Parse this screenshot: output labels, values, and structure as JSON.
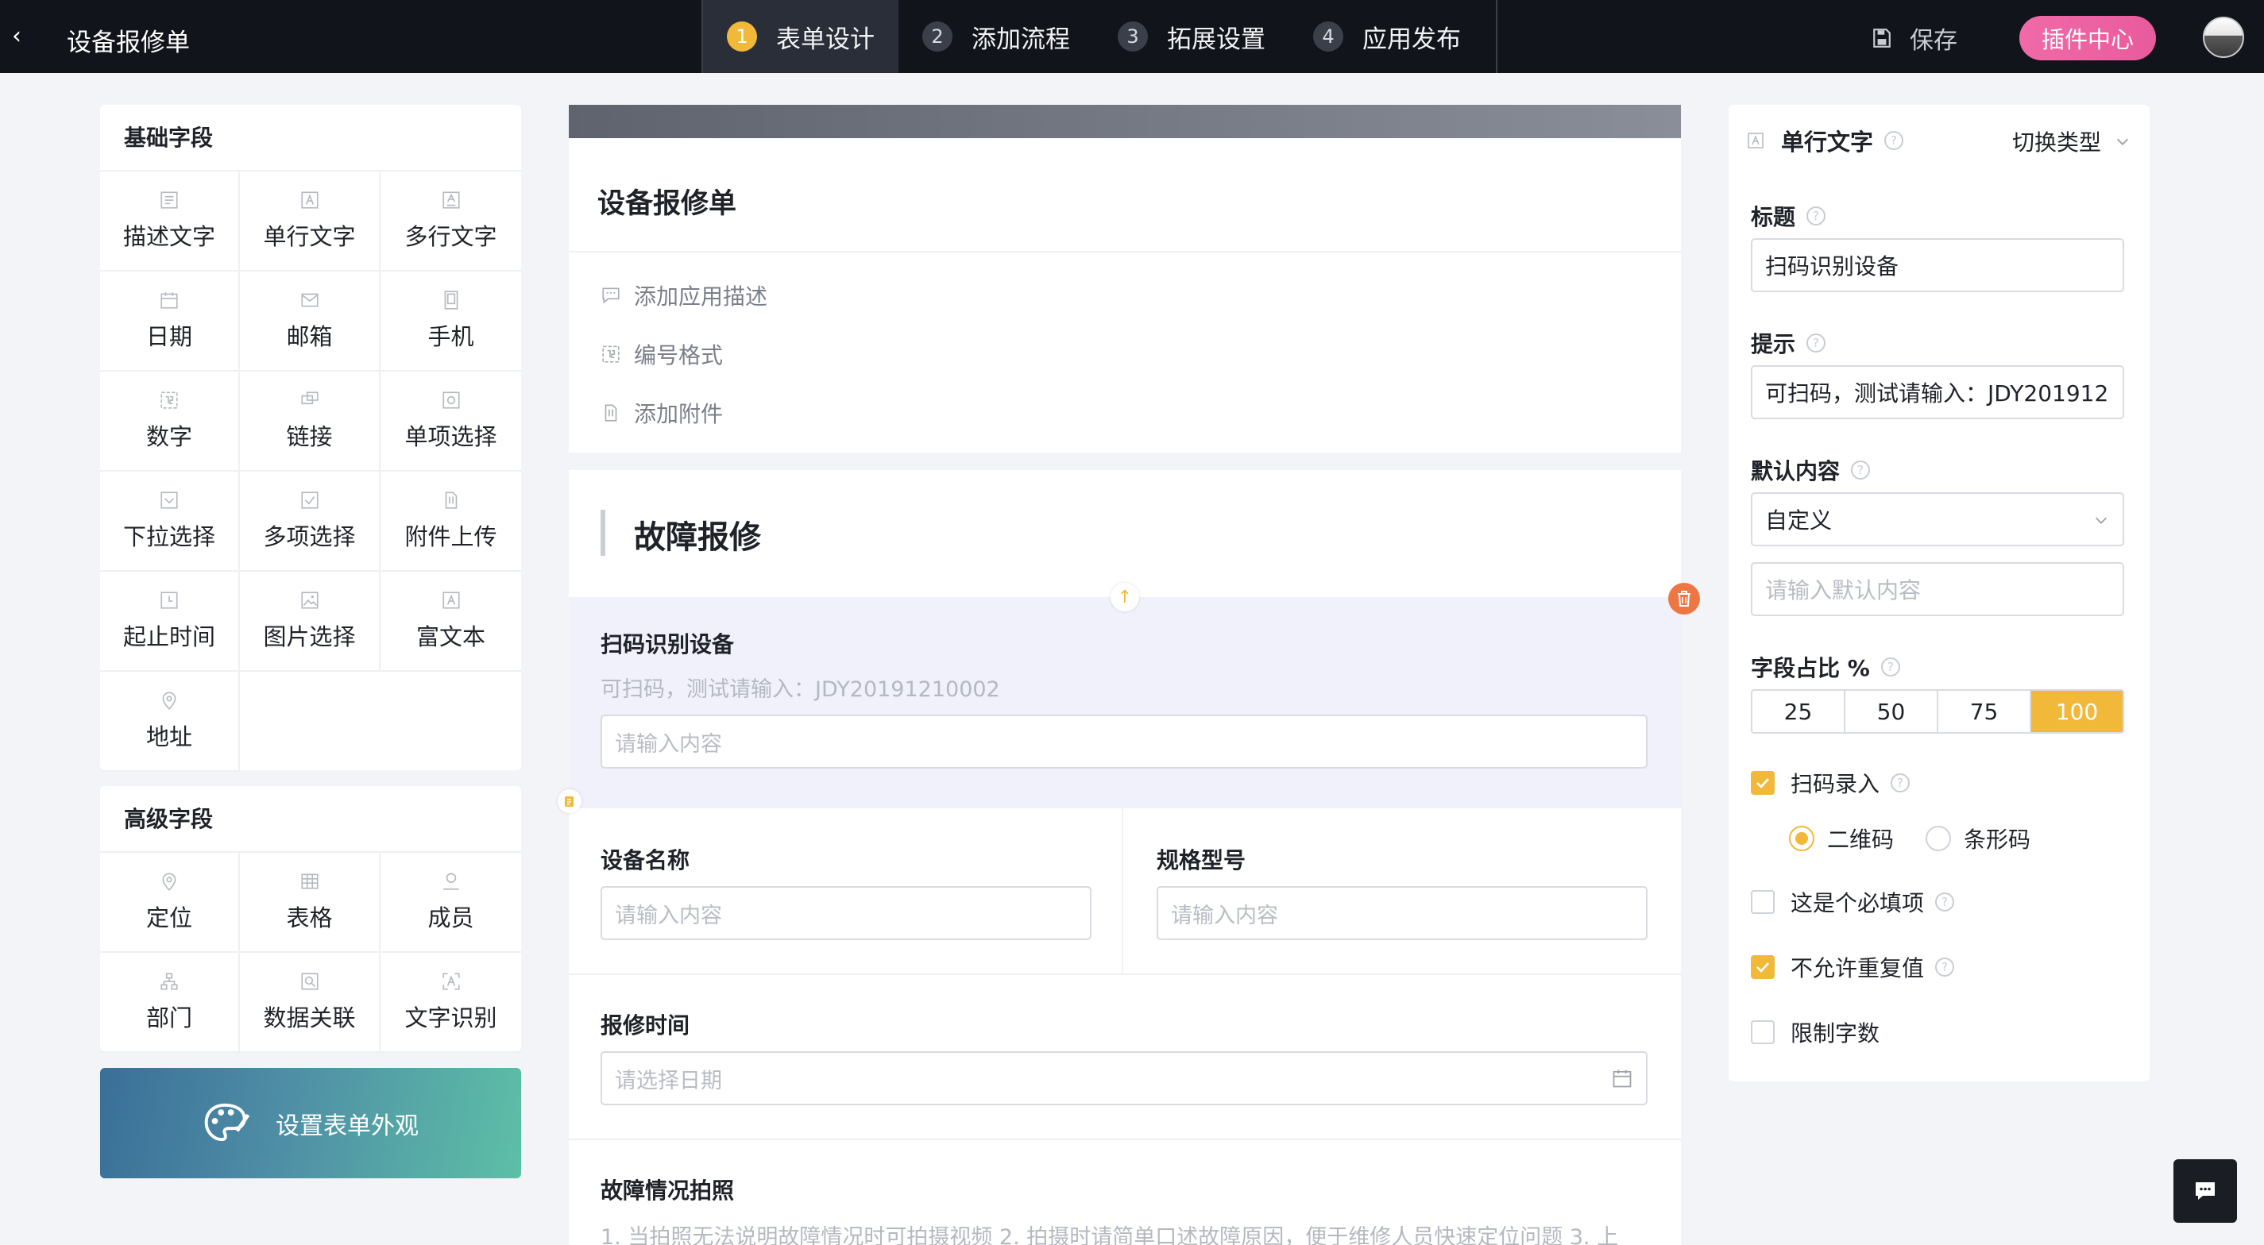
{
  "header": {
    "title": "设备报修单",
    "steps": [
      {
        "num": "1",
        "label": "表单设计"
      },
      {
        "num": "2",
        "label": "添加流程"
      },
      {
        "num": "3",
        "label": "拓展设置"
      },
      {
        "num": "4",
        "label": "应用发布"
      }
    ],
    "save_label": "保存",
    "plugin_label": "插件中心"
  },
  "left": {
    "basic_title": "基础字段",
    "basic_items": [
      "描述文字",
      "单行文字",
      "多行文字",
      "日期",
      "邮箱",
      "手机",
      "数字",
      "链接",
      "单项选择",
      "下拉选择",
      "多项选择",
      "附件上传",
      "起止时间",
      "图片选择",
      "富文本",
      "地址"
    ],
    "advanced_title": "高级字段",
    "advanced_items": [
      "定位",
      "表格",
      "成员",
      "部门",
      "数据关联",
      "文字识别"
    ],
    "appearance_label": "设置表单外观"
  },
  "form": {
    "title": "设备报修单",
    "links": [
      "添加应用描述",
      "编号格式",
      "添加附件"
    ],
    "section_title": "故障报修",
    "fields": {
      "scan": {
        "label": "扫码识别设备",
        "hint": "可扫码，测试请输入：JDY20191210002",
        "placeholder": "请输入内容"
      },
      "name": {
        "label": "设备名称",
        "placeholder": "请输入内容"
      },
      "model": {
        "label": "规格型号",
        "placeholder": "请输入内容"
      },
      "time": {
        "label": "报修时间",
        "placeholder": "请选择日期"
      },
      "photo": {
        "label": "故障情况拍照",
        "hint": "1. 当拍照无法说明故障情况时可拍摄视频 2. 拍摄时请简单口述故障原因，便于维修人员快速定位问题 3. 上"
      }
    }
  },
  "props": {
    "type_label": "单行文字",
    "switch_label": "切换类型",
    "title_label": "标题",
    "title_value": "扫码识别设备",
    "hint_label": "提示",
    "hint_value": "可扫码，测试请输入：JDY201912",
    "default_label": "默认内容",
    "default_select": "自定义",
    "default_placeholder": "请输入默认内容",
    "ratio_label": "字段占比 %",
    "ratio_options": [
      "25",
      "50",
      "75",
      "100"
    ],
    "ratio_selected": "100",
    "scan_input_label": "扫码录入",
    "scan_input_checked": true,
    "qr_label": "二维码",
    "qr_selected": true,
    "barcode_label": "条形码",
    "required_label": "这是个必填项",
    "required_checked": false,
    "no_dup_label": "不允许重复值",
    "no_dup_checked": true,
    "limit_label": "限制字数",
    "limit_checked": false
  },
  "colors": {
    "accent": "#f1b83a",
    "topbar": "#11141b",
    "plugin": "#e85b9c",
    "danger": "#ee7643"
  }
}
